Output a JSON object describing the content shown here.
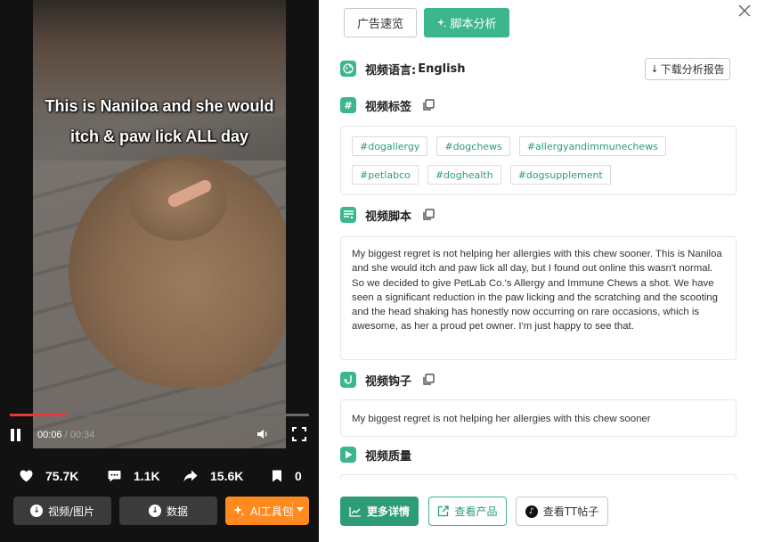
{
  "video": {
    "caption_line1": "This is Naniloa and she would",
    "caption_line2": "itch & paw lick ALL day",
    "current_time": "00:06",
    "separator": " / ",
    "duration": "00:34",
    "progress_fraction": 0.19
  },
  "stats": {
    "likes": "75.7K",
    "comments": "1.1K",
    "shares": "15.6K",
    "saves": "0"
  },
  "left_buttons": {
    "video_image": "视频/图片",
    "data": "数据",
    "ai_toolkit": "AI工具包"
  },
  "tabs": {
    "ad_preview": "广告速览",
    "script_analysis": "脚本分析"
  },
  "language": {
    "label": "视频语言:",
    "value": "English",
    "download_report": "下载分析报告"
  },
  "sections": {
    "tags_title": "视频标签",
    "script_title": "视频脚本",
    "hook_title": "视频钩子",
    "quality_title": "视频质量"
  },
  "tags": [
    "#dogallergy",
    "#dogchews",
    "#allergyandimmunechews",
    "#petlabco",
    "#doghealth",
    "#dogsupplement"
  ],
  "script_text": "My biggest regret is not helping her allergies with this chew sooner. This is Naniloa and she would itch and paw lick all day, but I found out online this wasn't normal. So we decided to give PetLab Co.'s Allergy and Immune Chews a shot. We have seen a significant reduction in the paw licking and the scratching and the scooting and the head shaking has honestly now occurring on rare occasions, which is awesome, as her a proud pet owner. I'm just happy to see that.",
  "hook_text": "My biggest regret is not helping her allergies with this chew sooner",
  "footer": {
    "more_details": "更多详情",
    "view_product": "查看产品",
    "view_tt_post": "查看TT帖子"
  },
  "colors": {
    "accent": "#3bb68f",
    "accent_dark": "#2f9c78",
    "ai_orange": "#ff8a1f",
    "progress_red": "#e63a3a"
  }
}
